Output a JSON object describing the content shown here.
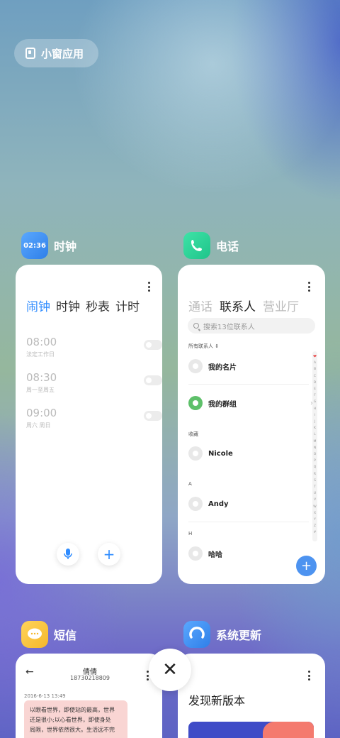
{
  "floating_apps": {
    "label": "小窗应用",
    "icon": "floating-window-icon"
  },
  "clock": {
    "app_name": "时钟",
    "icon_text": "02:36",
    "tabs": [
      "闹钟",
      "时钟",
      "秒表",
      "计时"
    ],
    "alarms": [
      {
        "time": "08:00",
        "repeat": "法定工作日",
        "enabled": false
      },
      {
        "time": "08:30",
        "repeat": "周一至周五",
        "enabled": false
      },
      {
        "time": "09:00",
        "repeat": "周六 周日",
        "enabled": false
      }
    ],
    "accent": "#2f8cff"
  },
  "phone": {
    "app_name": "电话",
    "tabs": [
      "通话",
      "联系人",
      "营业厅"
    ],
    "search_placeholder": "搜索13位联系人",
    "filter_label": "所有联系人",
    "my_card": "我的名片",
    "my_groups": "我的群组",
    "favorites_header": "收藏",
    "favorite_contact": "Nicole",
    "section_a": "A",
    "contact_a": "Andy",
    "section_h": "H",
    "contact_h": "哈哈",
    "index_letters": [
      "A",
      "B",
      "C",
      "D",
      "E",
      "F",
      "G",
      "H",
      "I",
      "J",
      "K",
      "L",
      "M",
      "N",
      "O",
      "P",
      "Q",
      "R",
      "S",
      "T",
      "U",
      "V",
      "W",
      "X",
      "Y",
      "Z",
      "#"
    ],
    "accent": "#4d93f0"
  },
  "sms": {
    "app_name": "短信",
    "contact_name": "倩倩",
    "contact_number": "18730218809",
    "timestamp": "2016-6-13 13:49",
    "message_lines": [
      "以眼看世界，即使站的最高，世界",
      "还是很小;以心看世界，即使身处",
      "局限，世界依然很大。生活远不完"
    ]
  },
  "update": {
    "app_name": "系统更新",
    "heading": "发现新版本"
  },
  "close_button": "✕"
}
